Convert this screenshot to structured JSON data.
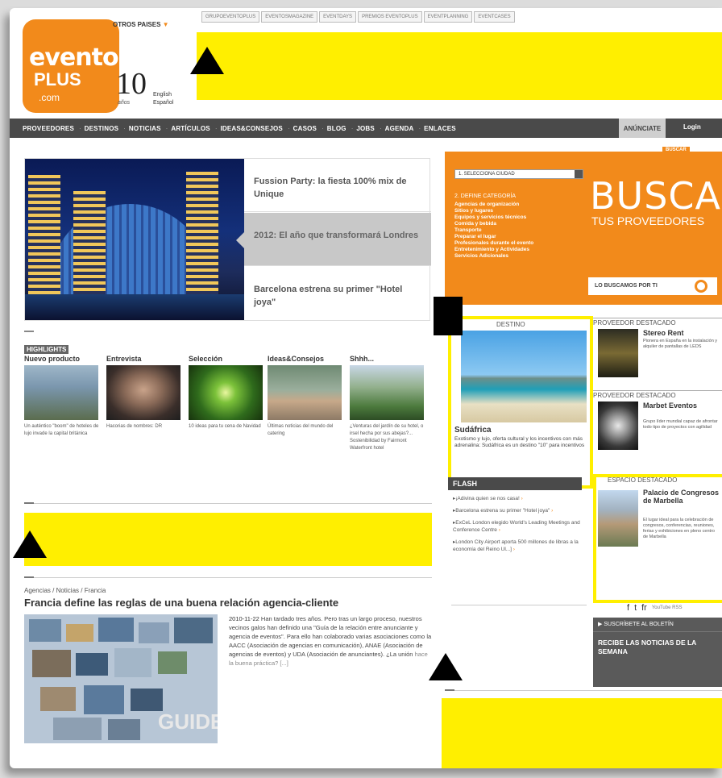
{
  "header": {
    "logo": {
      "line1": "evento",
      "line2": "PLUS",
      "line3": ".com"
    },
    "years": "10",
    "years_label": "años",
    "otros_paises": "OTROS PAISES",
    "lang_en": "English",
    "lang_es": "Español",
    "top_tabs": [
      "GRUPOEVENTOPLUS",
      "EVENTOSMAGAZINE",
      "EVENTDAYS",
      "PREMIOS EVENTOPLUS",
      "EVENTPLANNING",
      "EVENTCASES"
    ]
  },
  "nav": {
    "items": [
      "PROVEEDORES",
      "DESTINOS",
      "NOTICIAS",
      "ARTÍCULOS",
      "IDEAS&CONSEJOS",
      "CASOS",
      "BLOG",
      "JOBS",
      "AGENDA",
      "ENLACES"
    ],
    "anunciate": "ANÚNCIATE",
    "login": "Login"
  },
  "feature": {
    "stories": [
      "Fussion Party: la fiesta 100% mix de Unique",
      "2012: El año que transformará Londres",
      "Barcelona estrena su primer \"Hotel joya\""
    ]
  },
  "highlights": {
    "header": "HIGHLIGHTS",
    "items": [
      {
        "title": "Nuevo producto",
        "text": "Un auténtico \"boom\" de hoteles de lujo invade la capital británica"
      },
      {
        "title": "Entrevista",
        "text": "Hacorias de nombres: DR"
      },
      {
        "title": "Selección",
        "text": "10 ideas para tu cena de Navidad"
      },
      {
        "title": "Ideas&Consejos",
        "text": "Últimas noticias del mundo del catering"
      },
      {
        "title": "Shhh...",
        "text": "¿Venturas del jardín de su hotel, o irsel hecha por sus abejas?... Sostenibilidad by Fairmont Waterfront hotel"
      }
    ]
  },
  "article": {
    "breadcrumb": "Agencias / Noticias / Francia",
    "title": "Francia define las reglas de una buena relación agencia-cliente",
    "date": "2010-11-22",
    "body": "Han tardado tres años. Pero tras un largo proceso, nuestros vecinos galos han definido una \"Guía de la relación entre anunciante y agencia de eventos\". Para ello han colaborado varias asociaciones como la AACC (Asociación de agencias en comunicación), ANAE (Asociación de agencias de eventos) y UDA (Asociación de anunciantes). ¿La unión",
    "more": "hace la buena práctica? [...]",
    "image_word": "GUIDE"
  },
  "search": {
    "tag": "BUSCAR",
    "city_select": "1. SELECCIONA CIUDAD",
    "category_title": "2. DEFINE CATEGORÍA",
    "categories": [
      "Agencias de organización",
      "Sitios y lugares",
      "Equipos y servicios técnicos",
      "Comida y bebida",
      "Transporte",
      "Preparar el lugar",
      "Profesionales durante el evento",
      "Entretenimiento y Actividades",
      "Servicios Adicionales"
    ],
    "busca": "BUSCA",
    "busca_sub": "TUS PROVEEDORES",
    "button": "LO BUSCAMOS POR TI"
  },
  "destino": {
    "header": "DESTINO",
    "name": "Sudáfrica",
    "text": "Exotismo y lujo, oferta cultural y los incentivos con más adrenalina: Sudáfrica es un destino \"10\" para incentivos"
  },
  "providers": [
    {
      "header": "PROVEEDOR DESTACADO",
      "name": "Stereo Rent",
      "text": "Pionera en España en la instalación y alquiler de pantallas de LEDS"
    },
    {
      "header": "PROVEEDOR DESTACADO",
      "name": "Marbet Eventos",
      "text": "Grupo líder mundial capaz de afrontar todo tipo de proyectos con agilidad"
    },
    {
      "header": "ESPACIO DESTACADO",
      "name": "Palacio de Congresos de Marbella",
      "text": "El lugar ideal para la celebración de congresos, conferencias, reuniones, ferias y exhibiciones en pleno centro de Marbella"
    }
  ],
  "flash": {
    "header": "FLASH",
    "items": [
      "¡Adivina quien se nos casa!",
      "Barcelona estrena su primer \"Hotel joya\"",
      "ExCeL London elegido World's Leading Meetings and Conference Centre",
      "London City Airport aporta 500 millones de libras a la economía del Reino Ul...]"
    ]
  },
  "social": {
    "icons": [
      "f",
      "t",
      "fr"
    ],
    "small": "YouTube  RSS"
  },
  "newsletter": {
    "header": "SUSCRÍBETE AL BOLETÍN",
    "body": "RECIBE LAS NOTICIAS DE LA SEMANA"
  },
  "colors": {
    "brand_orange": "#f28a1b",
    "banner_yellow": "#ffef00",
    "nav_gray": "#4a4a4a"
  }
}
